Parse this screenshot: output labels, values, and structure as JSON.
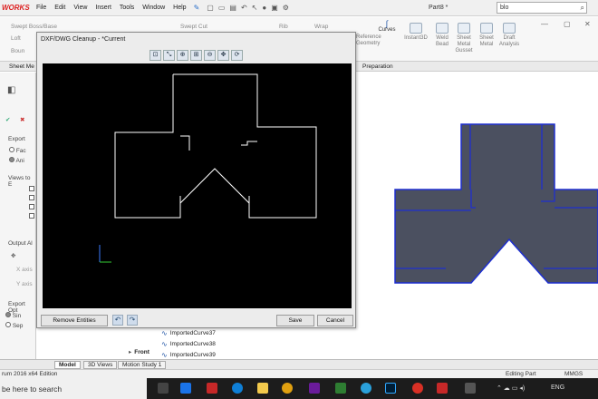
{
  "app": {
    "logo": "WORKS",
    "menu": [
      "File",
      "Edit",
      "View",
      "Insert",
      "Tools",
      "Window",
      "Help"
    ],
    "document_title": "Part8 *",
    "search_value": "blo"
  },
  "ribbon": {
    "items": [
      "Swept Boss/Base",
      "Loft",
      "Boun",
      "Swept Cut",
      "Rib",
      "Wrap",
      "Curves",
      "Instant3D",
      "Weld Bead",
      "Sheet Metal Gusset",
      "Sheet Metal",
      "Draft Analysis"
    ],
    "partial_items": [
      "Reference Geometry"
    ],
    "tabs": [
      "Sheet Me",
      "Preparation"
    ]
  },
  "left_panel": {
    "section_export": "Export",
    "opt_faces": "Fac",
    "opt_annotations": "Ani",
    "views_label": "Views to E",
    "output_label": "Output Al",
    "x_axis": "X axis",
    "y_axis": "Y axis",
    "export_opt_label": "Export Opt",
    "opt_single": "Sin",
    "opt_separate": "Sep"
  },
  "dialog": {
    "title": "DXF/DWG Cleanup - *Current",
    "remove_entities": "Remove Entities",
    "save": "Save",
    "cancel": "Cancel"
  },
  "tree": {
    "items": [
      "ImportedCurve37",
      "ImportedCurve38",
      "ImportedCurve39"
    ],
    "front": "Front"
  },
  "bottom_tabs": [
    "Model",
    "3D Views",
    "Motion Study 1"
  ],
  "status": {
    "edition": "rum 2016 x64 Edition",
    "mode": "Editing Part",
    "units": "MMGS"
  },
  "taskbar": {
    "search": "be here to search",
    "lang": "ENG"
  },
  "colors": {
    "part_fill": "#4b5060",
    "part_edges": "#1e2fd0",
    "canvas_bg": "#000000",
    "canvas_lines": "#ffffff",
    "logo": "#dd2222"
  }
}
